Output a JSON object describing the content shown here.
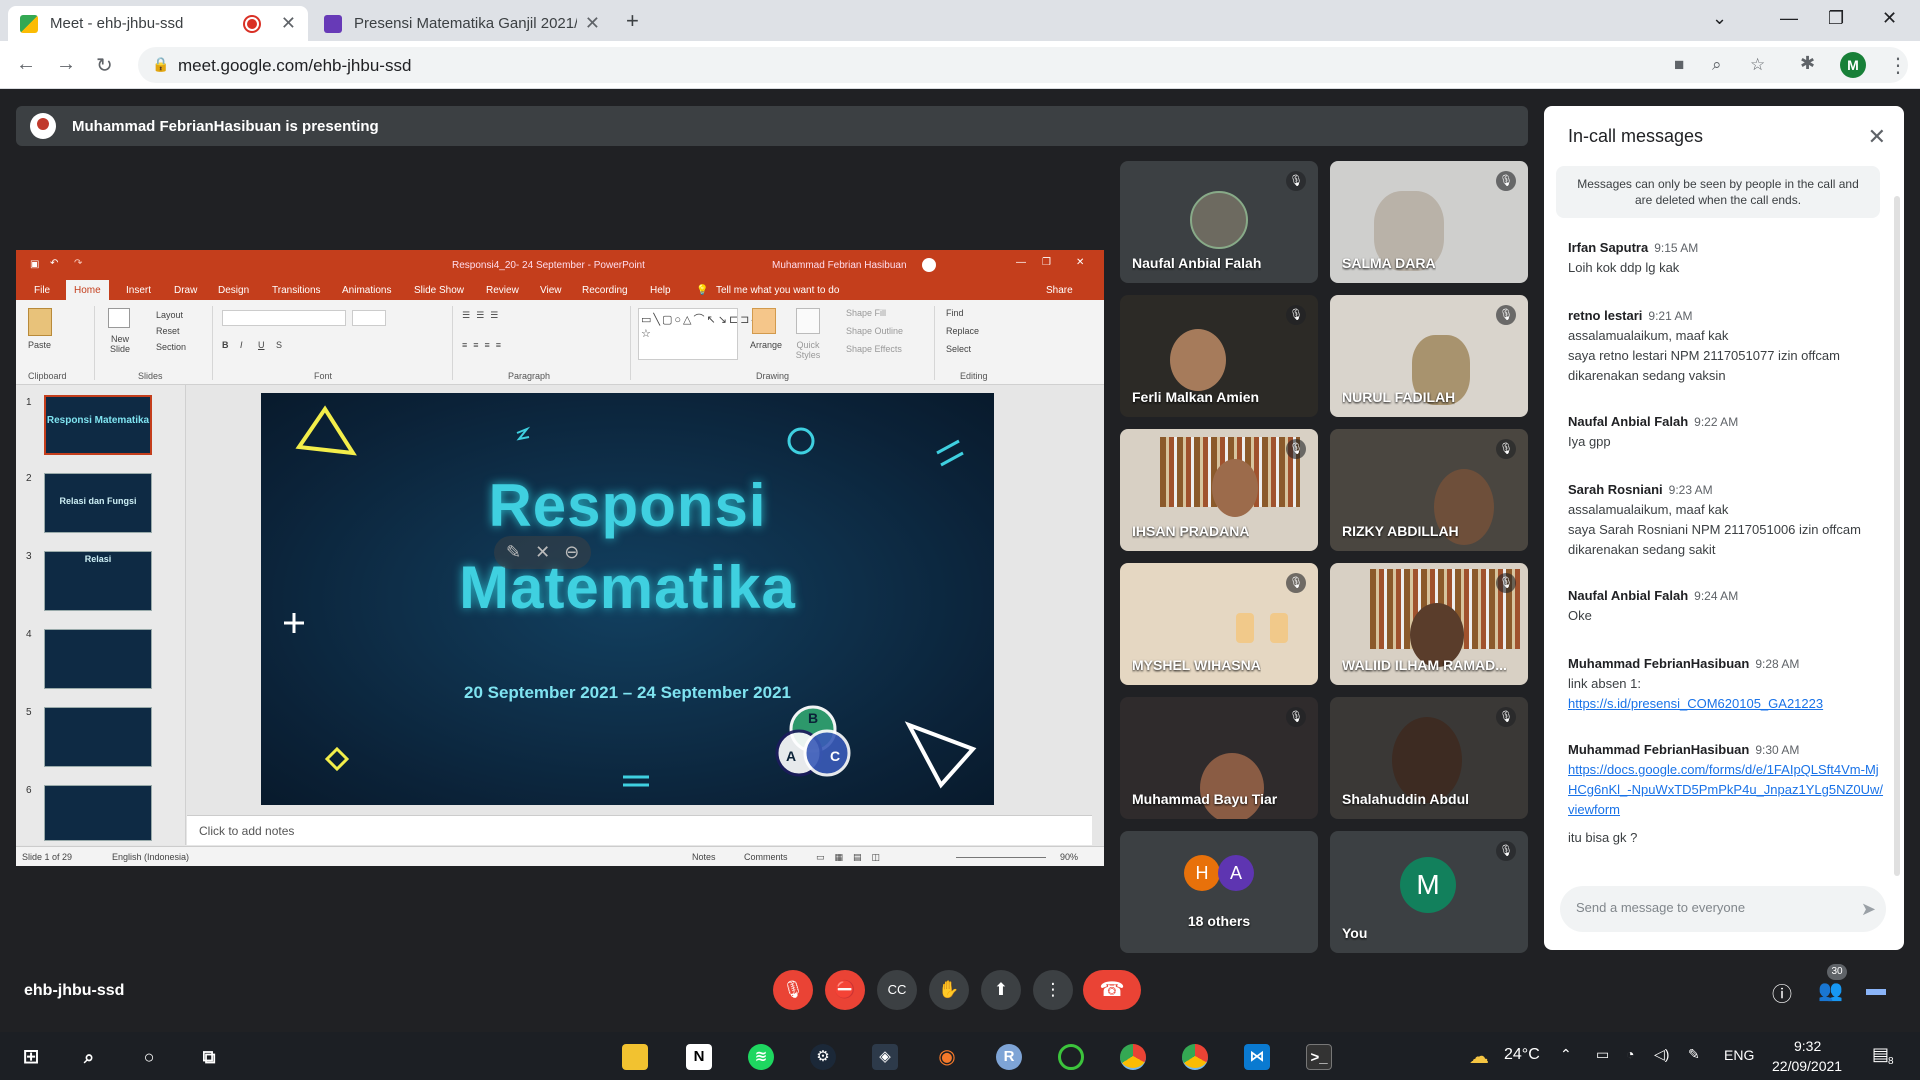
{
  "browser": {
    "tabs": [
      {
        "title": "Meet - ehb-jhbu-ssd",
        "active": true
      },
      {
        "title": "Presensi Matematika Ganjil 2021/",
        "active": false
      }
    ],
    "url": "meet.google.com/ehb-jhbu-ssd",
    "profile_initial": "M"
  },
  "meet": {
    "presenting_banner": "Muhammad FebrianHasibuan is presenting",
    "meeting_code": "ehb-jhbu-ssd",
    "participants_count": "30",
    "tiles": [
      {
        "name": "Naufal Anbial Falah"
      },
      {
        "name": "SALMA DARA"
      },
      {
        "name": "Ferli Malkan Amien"
      },
      {
        "name": "NURUL FADILAH"
      },
      {
        "name": "IHSAN PRADANA"
      },
      {
        "name": "RIZKY ABDILLAH"
      },
      {
        "name": "MYSHEL WIHASNA"
      },
      {
        "name": "WALIID ILHAM RAMAD..."
      },
      {
        "name": "Muhammad Bayu Tiar"
      },
      {
        "name": "Shalahuddin Abdul"
      }
    ],
    "others": {
      "initials": [
        "H",
        "A"
      ],
      "label": "18 others"
    },
    "self": {
      "initial": "M",
      "label": "You"
    }
  },
  "ppt": {
    "window_title": "Responsi4_20- 24 September  -  PowerPoint",
    "user": "Muhammad Febrian Hasibuan",
    "tabs": [
      "File",
      "Home",
      "Insert",
      "Draw",
      "Design",
      "Transitions",
      "Animations",
      "Slide Show",
      "Review",
      "View",
      "Recording",
      "Help"
    ],
    "tell_me": "Tell me what you want to do",
    "share": "Share",
    "ribbon": {
      "paste": "Paste",
      "clipboard": "Clipboard",
      "new_slide": "New Slide",
      "layout": "Layout",
      "reset": "Reset",
      "section": "Section",
      "slides": "Slides",
      "font": "Font",
      "paragraph": "Paragraph",
      "arrange": "Arrange",
      "quick_styles": "Quick Styles",
      "shape_fill": "Shape Fill",
      "shape_outline": "Shape Outline",
      "shape_effects": "Shape Effects",
      "drawing": "Drawing",
      "find": "Find",
      "replace": "Replace",
      "select": "Select",
      "editing": "Editing"
    },
    "thumbs": [
      {
        "num": "1",
        "text": "Responsi Matematika"
      },
      {
        "num": "2",
        "text": "Relasi dan Fungsi"
      },
      {
        "num": "3",
        "text": "Relasi"
      },
      {
        "num": "4",
        "text": ""
      },
      {
        "num": "5",
        "text": ""
      },
      {
        "num": "6",
        "text": ""
      }
    ],
    "slide": {
      "title_line1": "Responsi",
      "title_line2": "Matematika",
      "date": "20 September 2021 – 24 September 2021",
      "venn": [
        "B",
        "A",
        "C"
      ]
    },
    "notes_placeholder": "Click to add notes",
    "status": {
      "slide": "Slide 1 of 29",
      "language": "English (Indonesia)",
      "notes": "Notes",
      "comments": "Comments",
      "zoom": "90%"
    }
  },
  "chat": {
    "title": "In-call messages",
    "notice": "Messages can only be seen by people in the call and are deleted when the call ends.",
    "messages": [
      {
        "sender": "Irfan Saputra",
        "time": "9:15 AM",
        "lines": [
          "Loih kok ddp lg kak"
        ]
      },
      {
        "sender": "retno lestari",
        "time": "9:21 AM",
        "lines": [
          "assalamualaikum, maaf kak",
          "saya retno lestari NPM 2117051077 izin offcam dikarenakan sedang vaksin"
        ]
      },
      {
        "sender": "Naufal Anbial Falah",
        "time": "9:22 AM",
        "lines": [
          "Iya gpp"
        ]
      },
      {
        "sender": "Sarah Rosniani",
        "time": "9:23 AM",
        "lines": [
          "assalamualaikum, maaf kak",
          "saya Sarah Rosniani NPM 2117051006 izin offcam dikarenakan sedang sakit"
        ]
      },
      {
        "sender": "Naufal Anbial Falah",
        "time": "9:24 AM",
        "lines": [
          "Oke"
        ]
      },
      {
        "sender": "Muhammad FebrianHasibuan",
        "time": "9:28 AM",
        "lines": [
          "link absen 1:"
        ],
        "link": "https://s.id/presensi_COM620105_GA21223"
      },
      {
        "sender": "Muhammad FebrianHasibuan",
        "time": "9:30 AM",
        "lines": [],
        "link": "https://docs.google.com/forms/d/e/1FAIpQLSft4Vm-MjHCg6nKl_-NpuWxTD5PmPkP4u_Jnpaz1YLg5NZ0Uw/viewform",
        "after": "itu bisa gk ?"
      }
    ],
    "input_placeholder": "Send a message to everyone"
  },
  "taskbar": {
    "weather": "24°C",
    "lang": "ENG",
    "time": "9:32",
    "date": "22/09/2021",
    "notif_count": "8"
  },
  "colors": {
    "meet_bg": "#202124",
    "ppt_red": "#c43e1c",
    "end_call": "#ea4335",
    "slide_teal": "#3fd0e0"
  }
}
